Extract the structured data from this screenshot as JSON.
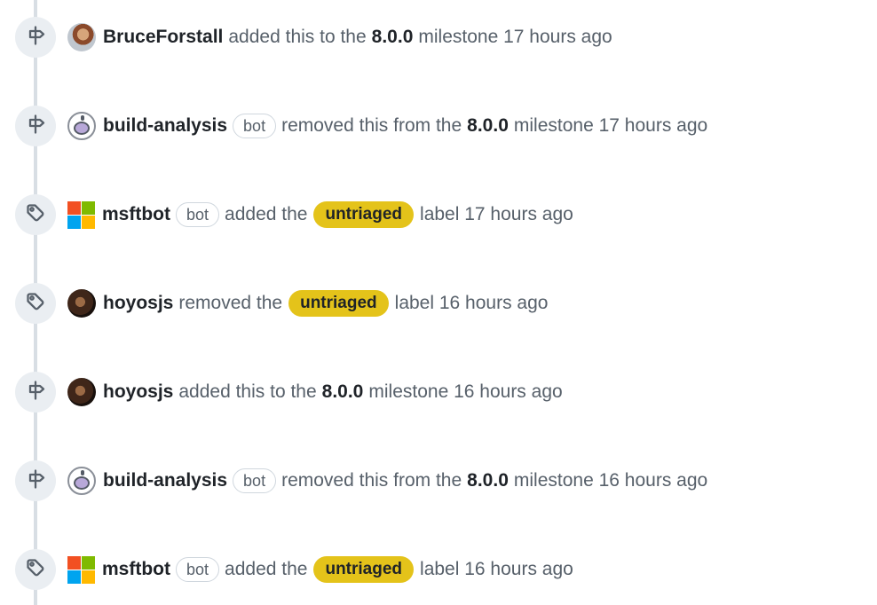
{
  "colors": {
    "timeline": "#d8dee4",
    "badge_bg": "#eaeef2",
    "icon": "#57606a",
    "label_untriaged": "#e4c31a"
  },
  "events": [
    {
      "icon": "milestone-icon",
      "actor": "BruceForstall",
      "bot": "",
      "before": "added this to the",
      "strong": "8.0.0",
      "label": "",
      "after": "milestone 17 hours ago"
    },
    {
      "icon": "milestone-icon",
      "actor": "build-analysis",
      "bot": "bot",
      "before": "removed this from the",
      "strong": "8.0.0",
      "label": "",
      "after": "milestone 17 hours ago"
    },
    {
      "icon": "tag-icon",
      "actor": "msftbot",
      "bot": "bot",
      "before": "added the",
      "strong": "",
      "label": "untriaged",
      "after": "label 17 hours ago"
    },
    {
      "icon": "tag-icon",
      "actor": "hoyosjs",
      "bot": "",
      "before": "removed the",
      "strong": "",
      "label": "untriaged",
      "after": "label 16 hours ago"
    },
    {
      "icon": "milestone-icon",
      "actor": "hoyosjs",
      "bot": "",
      "before": "added this to the",
      "strong": "8.0.0",
      "label": "",
      "after": "milestone 16 hours ago"
    },
    {
      "icon": "milestone-icon",
      "actor": "build-analysis",
      "bot": "bot",
      "before": "removed this from the",
      "strong": "8.0.0",
      "label": "",
      "after": "milestone 16 hours ago"
    },
    {
      "icon": "tag-icon",
      "actor": "msftbot",
      "bot": "bot",
      "before": "added the",
      "strong": "",
      "label": "untriaged",
      "after": "label 16 hours ago"
    }
  ]
}
